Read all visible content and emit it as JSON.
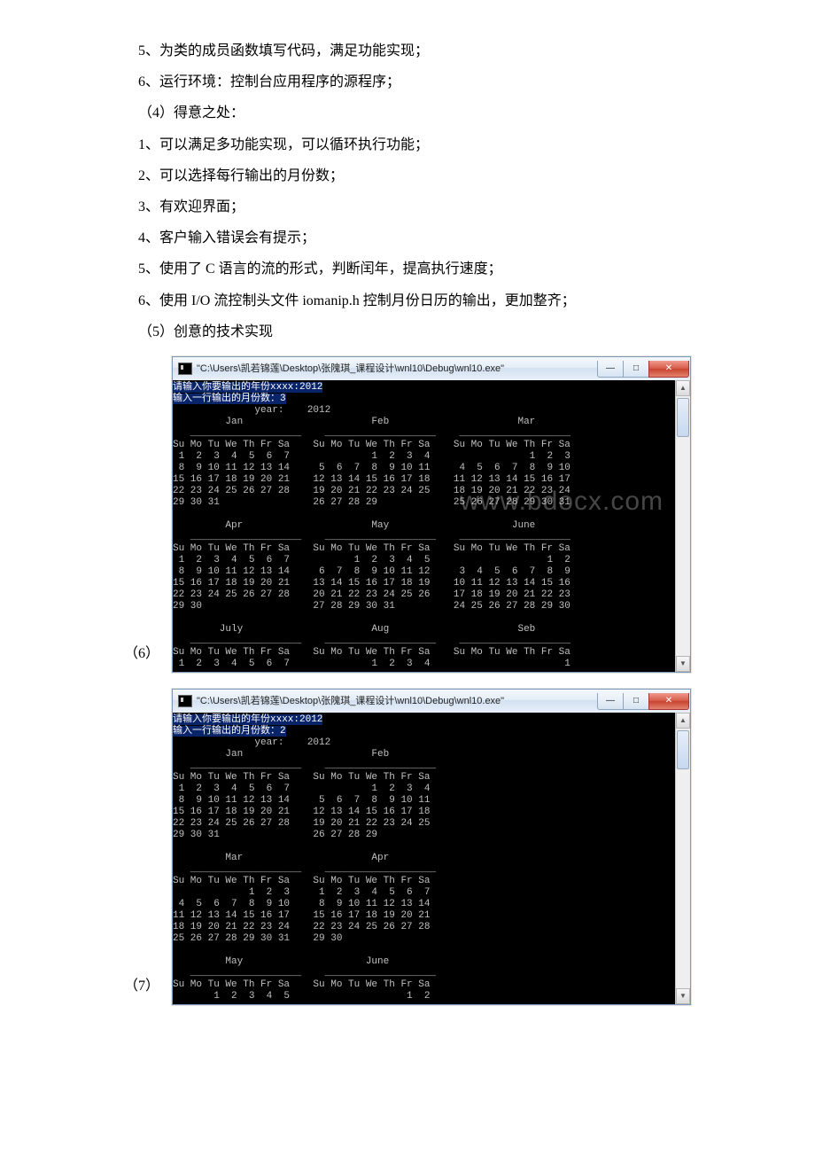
{
  "text": {
    "p1": "5、为类的成员函数填写代码，满足功能实现；",
    "p2": "6、运行环境：控制台应用程序的源程序；",
    "p3": "（4）得意之处：",
    "p4": "1、可以满足多功能实现，可以循环执行功能；",
    "p5": "2、可以选择每行输出的月份数；",
    "p6": "3、有欢迎界面；",
    "p7": "4、客户输入错误会有提示；",
    "p8": "5、使用了 C 语言的流的形式，判断闰年，提高执行速度；",
    "p9": "6、使用 I/O 流控制头文件 iomanip.h 控制月份日历的输出，更加整齐；",
    "p10": "（5）创意的技术实现",
    "label6": "（6）",
    "label7": "（7）"
  },
  "window": {
    "title": "\"C:\\Users\\凯若锦莲\\Desktop\\张隗琪_课程设计\\wnl10\\Debug\\wnl10.exe\"",
    "min_icon": "—",
    "max_icon": "□",
    "close_icon": "✕",
    "up_arrow": "▲",
    "down_arrow": "▼"
  },
  "watermark": "www.bdocx.com",
  "console1": {
    "prompt1": "请输入你要输出的年份xxxx:2012",
    "prompt2": "输入一行输出的月份数：3",
    "body": "              year:    2012\n         Jan                      Feb                      Mar\n   ___________________    ___________________    ___________________\nSu Mo Tu We Th Fr Sa    Su Mo Tu We Th Fr Sa    Su Mo Tu We Th Fr Sa\n 1  2  3  4  5  6  7              1  2  3  4                 1  2  3\n 8  9 10 11 12 13 14     5  6  7  8  9 10 11     4  5  6  7  8  9 10\n15 16 17 18 19 20 21    12 13 14 15 16 17 18    11 12 13 14 15 16 17\n22 23 24 25 26 27 28    19 20 21 22 23 24 25    18 19 20 21 22 23 24\n29 30 31                26 27 28 29             25 26 27 28 29 30 31\n\n         Apr                      May                     June\n   ___________________    ___________________    ___________________\nSu Mo Tu We Th Fr Sa    Su Mo Tu We Th Fr Sa    Su Mo Tu We Th Fr Sa\n 1  2  3  4  5  6  7           1  2  3  4  5                    1  2\n 8  9 10 11 12 13 14     6  7  8  9 10 11 12     3  4  5  6  7  8  9\n15 16 17 18 19 20 21    13 14 15 16 17 18 19    10 11 12 13 14 15 16\n22 23 24 25 26 27 28    20 21 22 23 24 25 26    17 18 19 20 21 22 23\n29 30                   27 28 29 30 31          24 25 26 27 28 29 30\n\n        July                      Aug                      Seb\n   ___________________    ___________________    ___________________\nSu Mo Tu We Th Fr Sa    Su Mo Tu We Th Fr Sa    Su Mo Tu We Th Fr Sa\n 1  2  3  4  5  6  7              1  2  3  4                       1"
  },
  "console2": {
    "prompt1": "请输入你要输出的年份xxxx:2012",
    "prompt2": "输入一行输出的月份数：2",
    "body": "              year:    2012\n         Jan                      Feb\n   ___________________    ___________________\nSu Mo Tu We Th Fr Sa    Su Mo Tu We Th Fr Sa\n 1  2  3  4  5  6  7              1  2  3  4\n 8  9 10 11 12 13 14     5  6  7  8  9 10 11\n15 16 17 18 19 20 21    12 13 14 15 16 17 18\n22 23 24 25 26 27 28    19 20 21 22 23 24 25\n29 30 31                26 27 28 29\n\n         Mar                      Apr\n   ___________________    ___________________\nSu Mo Tu We Th Fr Sa    Su Mo Tu We Th Fr Sa\n             1  2  3     1  2  3  4  5  6  7\n 4  5  6  7  8  9 10     8  9 10 11 12 13 14\n11 12 13 14 15 16 17    15 16 17 18 19 20 21\n18 19 20 21 22 23 24    22 23 24 25 26 27 28\n25 26 27 28 29 30 31    29 30\n\n         May                     June\n   ___________________    ___________________\nSu Mo Tu We Th Fr Sa    Su Mo Tu We Th Fr Sa\n       1  2  3  4  5                    1  2"
  }
}
